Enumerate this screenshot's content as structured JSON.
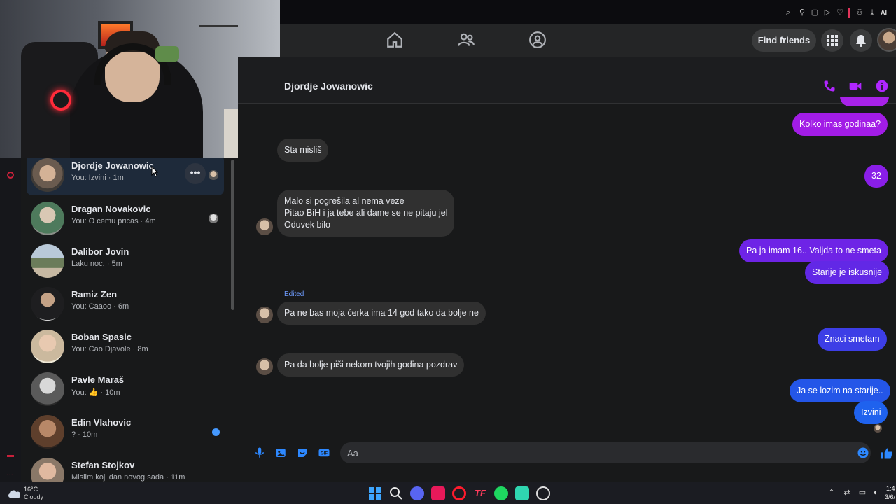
{
  "browser": {
    "extension_label": "AI",
    "icons": [
      "zoom-icon",
      "pin-icon",
      "tab-icon",
      "play-icon",
      "heart-icon",
      "download-icon",
      "extension-icon"
    ]
  },
  "facebook_header": {
    "nav": [
      "home-icon",
      "friends-icon",
      "groups-icon"
    ],
    "find_friends_label": "Find friends",
    "accent_color": "#a020f0"
  },
  "sidebar": {
    "conversations": [
      {
        "name": "Djordje Jowanowic",
        "preview": "You: Izvini · 1m",
        "active": true,
        "status": "seen"
      },
      {
        "name": "Dragan Novakovic",
        "preview": "You: O cemu pricas · 4m",
        "status": "seen"
      },
      {
        "name": "Dalibor Jovin",
        "preview": "Laku noc. · 5m",
        "status": "none"
      },
      {
        "name": "Ramiz Zen",
        "preview": "You: Caaoo · 6m",
        "status": "none"
      },
      {
        "name": "Boban Spasic",
        "preview": "You: Cao Djavole · 8m",
        "status": "none"
      },
      {
        "name": "Pavle Maraš",
        "preview": "You: 👍 · 10m",
        "status": "none"
      },
      {
        "name": "Edin Vlahovic",
        "preview": "? · 10m",
        "status": "unread"
      },
      {
        "name": "Stefan Stojkov",
        "preview": "Mislim koji dan novog sada · 11m",
        "status": "none"
      }
    ],
    "more_label": "•••"
  },
  "chat": {
    "contact_name": "Djordje Jowanowic",
    "header_icons": [
      "phone-icon",
      "video-icon",
      "info-icon"
    ],
    "messages": {
      "m1": "Kolko imas godinaa?",
      "m2": "Sta misliš",
      "m3": "32",
      "m4_l1": "Malo si pogrešila al nema veze",
      "m4_l2": "Pitao BiH i ja tebe ali dame se ne pitaju jel",
      "m4_l3": "Oduvek bilo",
      "m5": "Pa ja imam 16.. Valjda to ne smeta",
      "m6": "Starije je iskusnije",
      "edited": "Edited",
      "m7": "Pa ne bas moja ćerka ima   14 god tako da bolje ne",
      "m8": "Znaci smetam",
      "m9": "Pa da bolje piši nekom tvojih godina pozdrav",
      "m10": "Ja se lozim na starije..",
      "m11": "Izvini"
    },
    "composer": {
      "placeholder": "Aa",
      "icons": [
        "mic-icon",
        "image-icon",
        "sticker-icon",
        "gif-icon",
        "emoji-icon",
        "like-icon"
      ]
    }
  },
  "taskbar": {
    "weather_temp": "16°C",
    "weather_cond": "Cloudy",
    "time": "1:4",
    "date": "3/6/"
  }
}
